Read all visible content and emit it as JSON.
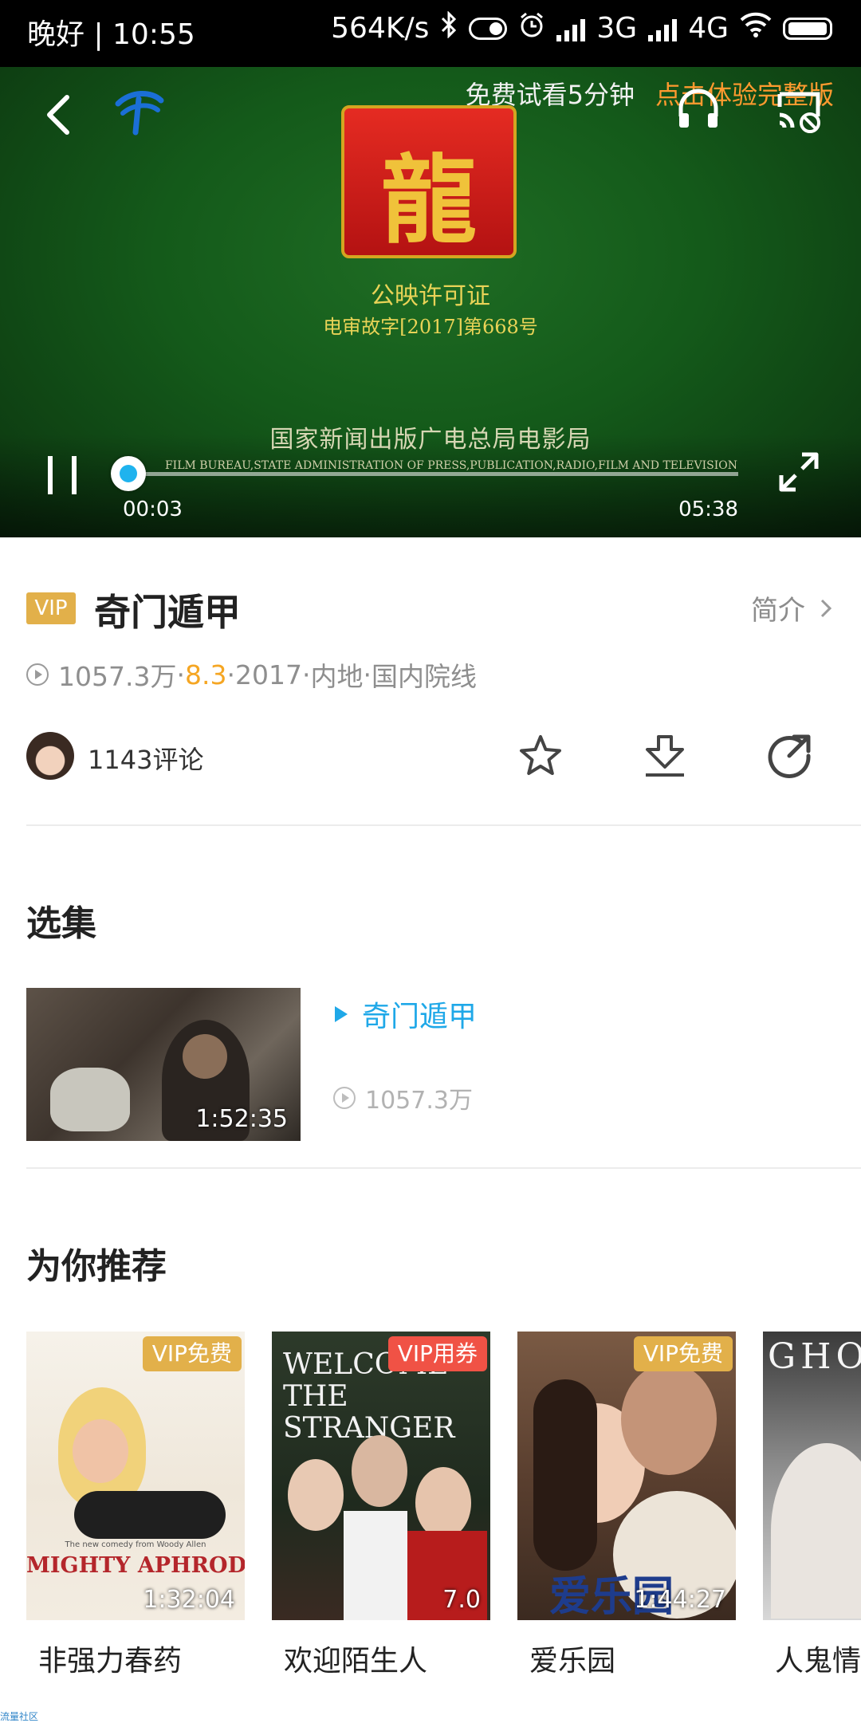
{
  "status_bar": {
    "left_text": "晚好 | 10:55",
    "speed": "564K/s",
    "net1": "3G",
    "net2": "4G",
    "icons": [
      "bluetooth-icon",
      "toggle-icon",
      "alarm-icon",
      "signal-icon",
      "wifi-icon",
      "battery-icon"
    ]
  },
  "player": {
    "trial_text": "免费试看5分钟",
    "upgrade_link": "点击体验完整版",
    "license_title": "公映许可证",
    "license_number": "电审故字[2017]第668号",
    "bureau_cn": "国家新闻出版广电总局电影局",
    "bureau_en": "FILM BUREAU,STATE ADMINISTRATION OF PRESS,PUBLICATION,RADIO,FILM AND TELEVISION",
    "current_time": "00:03",
    "total_time": "05:38",
    "progress_fraction": 0.009,
    "accent_color": "#1fb3ee"
  },
  "info": {
    "badge": "VIP",
    "title": "奇门遁甲",
    "intro_label": "简介",
    "views": "1057.3万",
    "sep": " · ",
    "rating": "8.3",
    "year": "2017",
    "region": "内地",
    "category": "国内院线",
    "comments": "1143评论"
  },
  "episodes": {
    "heading": "选集",
    "items": [
      {
        "title": "奇门遁甲",
        "duration": "1:52:35",
        "views": "1057.3万"
      }
    ]
  },
  "recommend": {
    "heading": "为你推荐",
    "items": [
      {
        "title": "非强力春药",
        "badge": "VIP免费",
        "badge_color": "gold",
        "overlay": "1:32:04",
        "poster_heading": "MIGHTY APHRODITE",
        "poster_tagline": "The new comedy from Woody Allen"
      },
      {
        "title": "欢迎陌生人",
        "badge": "VIP用券",
        "badge_color": "red",
        "overlay": "7.0",
        "poster_heading": "WELCOME THE STRANGER"
      },
      {
        "title": "爱乐园",
        "badge": "VIP免费",
        "badge_color": "gold",
        "overlay": "1:44:27",
        "poster_heading": "爱乐园"
      },
      {
        "title": "人鬼情",
        "poster_heading": "GHO"
      }
    ]
  },
  "footer": {
    "watermark": "流量社区"
  }
}
